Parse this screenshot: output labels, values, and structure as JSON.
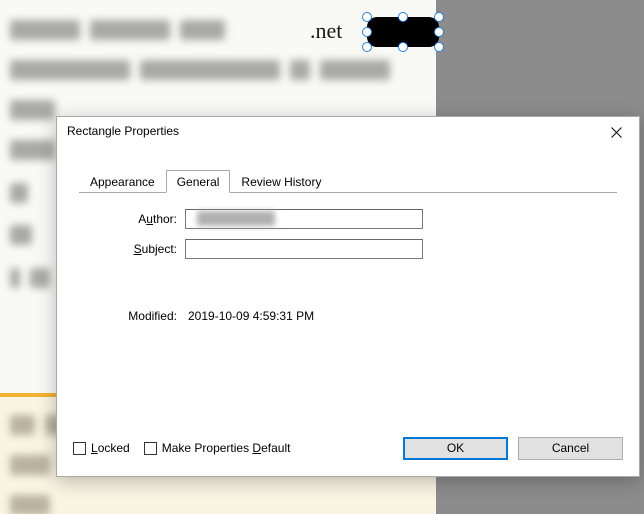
{
  "background": {
    "visible_text": ".net"
  },
  "dialog": {
    "title": "Rectangle Properties",
    "tabs": [
      {
        "label": "Appearance",
        "active": false
      },
      {
        "label": "General",
        "active": true
      },
      {
        "label": "Review History",
        "active": false
      }
    ],
    "fields": {
      "author_label_pre": "A",
      "author_label_uline": "u",
      "author_label_post": "thor:",
      "author_value": "",
      "subject_label_pre": "",
      "subject_label_uline": "S",
      "subject_label_post": "ubject:",
      "subject_value": "",
      "modified_label": "Modified:",
      "modified_value": "2019-10-09 4:59:31 PM"
    },
    "footer": {
      "locked_pre": "",
      "locked_uline": "L",
      "locked_post": "ocked",
      "default_pre": "Make Properties ",
      "default_uline": "D",
      "default_post": "efault",
      "ok": "OK",
      "cancel": "Cancel"
    }
  }
}
